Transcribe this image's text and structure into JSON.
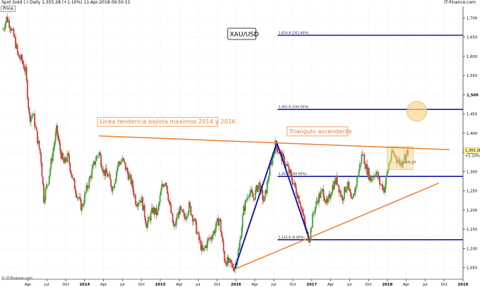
{
  "header": {
    "left_text": "Spot Gold (-)   Daily   1,355.28 (+1.10%)   11-Apr-2018 09:50:11",
    "right_text": "IT-Finance.com",
    "price_label": "Price"
  },
  "footer": {
    "copyright": "© IT-Finance.com"
  },
  "colors": {
    "fib_line": "#1a1aa8",
    "triangle_line": "#f07c2e",
    "zigzag": "#1a1aa8",
    "candle_up": "#3aa335",
    "candle_down": "#d33a3a",
    "annotation_text": "#f07c2e",
    "highlight": "#f5d98a",
    "grid": "#e9e9e9"
  },
  "chart_data": {
    "type": "candlestick",
    "symbol_box": "XAU/USD",
    "y_axis": {
      "min": 1020,
      "max": 1730,
      "ticks": [
        "1,050",
        "1,100",
        "1,150",
        "1,200",
        "1,250",
        "1,300",
        "1,350",
        "1,400",
        "1,450",
        "1,500",
        "1,550",
        "1,600",
        "1,650",
        "1,700"
      ],
      "bold_tick": "1,500"
    },
    "x_axis": {
      "start": 2012.9,
      "end": 2019.0,
      "ticks": [
        {
          "label": "Apr",
          "t": 2013.25
        },
        {
          "label": "Jul",
          "t": 2013.5
        },
        {
          "label": "Oct",
          "t": 2013.75
        },
        {
          "label": "2014",
          "t": 2014.0,
          "bold": true
        },
        {
          "label": "Apr",
          "t": 2014.25
        },
        {
          "label": "Jul",
          "t": 2014.5
        },
        {
          "label": "Oct",
          "t": 2014.75
        },
        {
          "label": "2015",
          "t": 2015.0,
          "bold": true
        },
        {
          "label": "Apr",
          "t": 2015.25
        },
        {
          "label": "Jul",
          "t": 2015.5
        },
        {
          "label": "Oct",
          "t": 2015.75
        },
        {
          "label": "2016",
          "t": 2016.0,
          "bold": true
        },
        {
          "label": "Apr",
          "t": 2016.25
        },
        {
          "label": "Jul",
          "t": 2016.5
        },
        {
          "label": "Oct",
          "t": 2016.75
        },
        {
          "label": "2017",
          "t": 2017.0,
          "bold": true
        },
        {
          "label": "Apr",
          "t": 2017.25
        },
        {
          "label": "Jul",
          "t": 2017.5
        },
        {
          "label": "Oct",
          "t": 2017.75
        },
        {
          "label": "2018",
          "t": 2018.0,
          "bold": true
        },
        {
          "label": "Apr",
          "t": 2018.25
        },
        {
          "label": "Jul",
          "t": 2018.5
        },
        {
          "label": "Oct",
          "t": 2018.75
        },
        {
          "label": "2019",
          "t": 2019.0,
          "bold": true
        }
      ]
    },
    "price_path": [
      [
        2012.92,
        1670
      ],
      [
        2012.97,
        1700
      ],
      [
        2013.02,
        1680
      ],
      [
        2013.08,
        1640
      ],
      [
        2013.12,
        1600
      ],
      [
        2013.17,
        1590
      ],
      [
        2013.22,
        1560
      ],
      [
        2013.27,
        1440
      ],
      [
        2013.32,
        1450
      ],
      [
        2013.37,
        1390
      ],
      [
        2013.42,
        1340
      ],
      [
        2013.46,
        1230
      ],
      [
        2013.52,
        1280
      ],
      [
        2013.57,
        1340
      ],
      [
        2013.63,
        1410
      ],
      [
        2013.67,
        1360
      ],
      [
        2013.72,
        1320
      ],
      [
        2013.78,
        1340
      ],
      [
        2013.84,
        1280
      ],
      [
        2013.9,
        1240
      ],
      [
        2013.96,
        1205
      ],
      [
        2014.02,
        1250
      ],
      [
        2014.08,
        1290
      ],
      [
        2014.14,
        1330
      ],
      [
        2014.19,
        1350
      ],
      [
        2014.25,
        1300
      ],
      [
        2014.31,
        1290
      ],
      [
        2014.37,
        1255
      ],
      [
        2014.44,
        1320
      ],
      [
        2014.5,
        1330
      ],
      [
        2014.56,
        1300
      ],
      [
        2014.62,
        1270
      ],
      [
        2014.68,
        1220
      ],
      [
        2014.75,
        1230
      ],
      [
        2014.82,
        1160
      ],
      [
        2014.9,
        1200
      ],
      [
        2014.96,
        1190
      ],
      [
        2015.02,
        1260
      ],
      [
        2015.07,
        1280
      ],
      [
        2015.12,
        1215
      ],
      [
        2015.18,
        1150
      ],
      [
        2015.25,
        1200
      ],
      [
        2015.32,
        1180
      ],
      [
        2015.38,
        1210
      ],
      [
        2015.45,
        1170
      ],
      [
        2015.5,
        1130
      ],
      [
        2015.56,
        1090
      ],
      [
        2015.63,
        1120
      ],
      [
        2015.7,
        1140
      ],
      [
        2015.78,
        1180
      ],
      [
        2015.85,
        1070
      ],
      [
        2015.92,
        1060
      ],
      [
        2015.98,
        1050
      ],
      [
        2016.04,
        1100
      ],
      [
        2016.1,
        1200
      ],
      [
        2016.17,
        1250
      ],
      [
        2016.23,
        1230
      ],
      [
        2016.3,
        1270
      ],
      [
        2016.37,
        1220
      ],
      [
        2016.44,
        1300
      ],
      [
        2016.52,
        1370
      ],
      [
        2016.6,
        1340
      ],
      [
        2016.68,
        1310
      ],
      [
        2016.76,
        1270
      ],
      [
        2016.85,
        1220
      ],
      [
        2016.93,
        1140
      ],
      [
        2016.97,
        1125
      ],
      [
        2017.02,
        1190
      ],
      [
        2017.08,
        1230
      ],
      [
        2017.15,
        1250
      ],
      [
        2017.2,
        1210
      ],
      [
        2017.27,
        1260
      ],
      [
        2017.33,
        1280
      ],
      [
        2017.4,
        1230
      ],
      [
        2017.47,
        1270
      ],
      [
        2017.53,
        1215
      ],
      [
        2017.6,
        1280
      ],
      [
        2017.67,
        1350
      ],
      [
        2017.72,
        1310
      ],
      [
        2017.78,
        1280
      ],
      [
        2017.85,
        1300
      ],
      [
        2017.9,
        1270
      ],
      [
        2017.96,
        1255
      ],
      [
        2018.02,
        1320
      ],
      [
        2018.07,
        1350
      ],
      [
        2018.12,
        1335
      ],
      [
        2018.18,
        1320
      ],
      [
        2018.23,
        1340
      ],
      [
        2018.28,
        1355
      ]
    ],
    "fibonacci_levels": [
      {
        "label": "1,654.8 (161.80%)",
        "value": 1654.8,
        "t_start": 2016.55
      },
      {
        "label": "1,461.8 (100.00%)",
        "value": 1461.8,
        "t_start": 2016.55
      },
      {
        "label": "1,287.5 (50.00%)",
        "value": 1287.5,
        "t_start": 2016.55
      },
      {
        "label": "1,122.8 (0.00%)",
        "value": 1122.8,
        "t_start": 2016.55
      }
    ],
    "zigzag": [
      [
        2015.98,
        1046
      ],
      [
        2016.54,
        1375
      ],
      [
        2016.97,
        1124
      ]
    ],
    "resistance_line": {
      "label": "Linea tendencia bajista maximos 2014 y 2016",
      "from": [
        2014.19,
        1393
      ],
      "to": [
        2018.82,
        1357
      ]
    },
    "support_line": {
      "from": [
        2015.98,
        1046
      ],
      "to": [
        2018.68,
        1270
      ]
    },
    "triangle_label": "Triangulo ascendente",
    "consolidation_box": {
      "t_start": 2018.0,
      "t_end": 2018.34,
      "min": 1305,
      "max": 1365
    },
    "consolidation_label": "1,305.28",
    "highlight_circle": {
      "t": 2018.39,
      "value": 1457
    },
    "last_price": {
      "label": "1,355.28",
      "value": 1355.28
    },
    "last_change": {
      "label": "+1.10%",
      "value": 1342
    }
  }
}
